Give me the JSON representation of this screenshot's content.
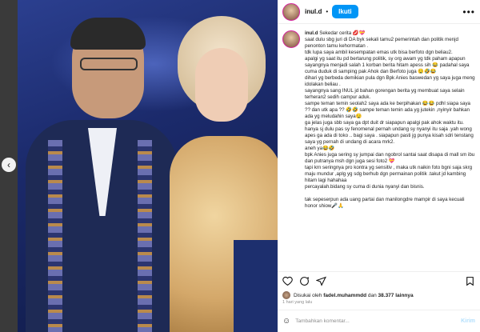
{
  "post": {
    "username": "inul.d",
    "follow_label": "Ikuti",
    "more_label": "•••",
    "caption_user": "inul.d",
    "caption": "Sekedar cerita 💋💝\nsaat dulu sbg juri di DA byk sekali tamu2 pemerintah dan politik menjd penonton tamu kehormatan .\ntdk lupa saya ambil kesempatan emas utk bisa berfoto dgn beliau2.\napalgi yg saat itu pd bertarung politik, sy org awam yg tdk paham apapun sayangnya menjadi salah 1 korban berita hitam apess sih 😂 padahal saya cuma duduk di samping pak Ahok dan Berfoto juga 🤤🤣😂\ndihari yg berbeda demikian pula dgn Bpk Anies baswedan yg saya juga meng idolakan beliau .\nsayangnya sang INUL jd bahan gorengan berita yg membuat saya selain terheran2 sedih campur aduk.\nsampe teman temin seolah2 saya ada ke berpihakan 😂😂 pdhl siapa saya ?? dan utk apa ?? 🤣🤣 sampe teman temin ada yg jutekin ,nyinyir bahkan ada yg meludahin saya🤤\nga jelas juga sbb saya ga dpt duit dr siapapun apalgi pak ahok waktu itu.\nhanya sj dulu pas sy fenomenal pernah undang sy nyanyi itu saja .yah wong apes ga ada di toko .. bagi saya . siapapun pasti jg punya kisah sdri tenstang saya yg pernah di undang di acara mrk2.\naneh ya😂🤣\nbpk Anies juga sering sy jumpai dan ngobrol santai saat disapa di mall sm ibu dan putranya msh dgn juga sesi foto2 💝\ntapi krn seringnya pro kontra yg sensitiv , maka utk naikin foto bgni saja skrg maju mundur ,aplg yg sdg berhub dgn permainan politik .takut jd kambing hitam lagi hahahaa\npercayalah.bidang sy cuma di dunia nyanyi dan bisnis.\n\ntak sepeserpun ada uang partai dan manilongdre mampir di saya kecuali honor shiow🎤🙏",
    "likes_prefix": "Disukai oleh",
    "liked_by": "fadel.muhammdd",
    "likes_mid": "dan",
    "likes_count": "38.377 lainnya",
    "time": "1 hari yang lalu",
    "comment_placeholder": "Tambahkan komentar...",
    "send_label": "Kirim"
  },
  "nav": {
    "prev_glyph": "‹"
  },
  "icons": [
    "heart-icon",
    "comment-icon",
    "share-icon",
    "bookmark-icon",
    "emoji-icon"
  ],
  "colors": {
    "accent": "#0095f6"
  }
}
